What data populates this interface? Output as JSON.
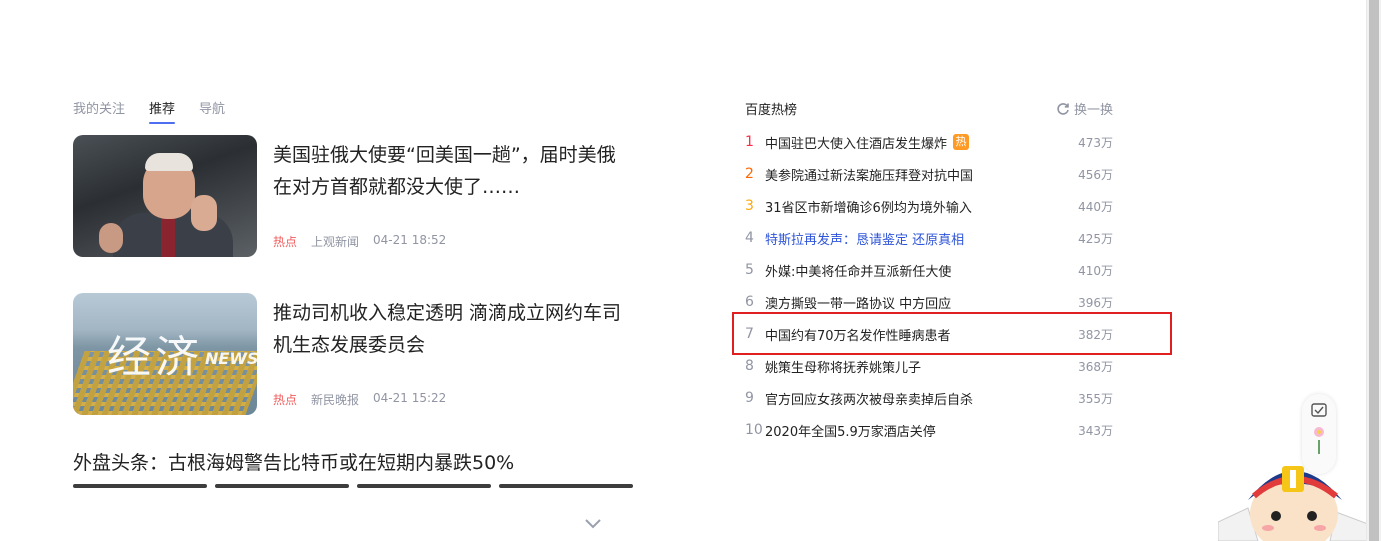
{
  "tabs": [
    {
      "label": "我的关注",
      "active": false
    },
    {
      "label": "推荐",
      "active": true
    },
    {
      "label": "导航",
      "active": false
    }
  ],
  "news": [
    {
      "title": "美国驻俄大使要“回美国一趟”，届时美俄在对方首都就都没大使了……",
      "tag": "热点",
      "source": "上观新闻",
      "time": "04-21 18:52"
    },
    {
      "title": "推动司机收入稳定透明 滴滴成立网约车司机生态发展委员会",
      "tag": "热点",
      "source": "新民晚报",
      "time": "04-21 15:22",
      "image_text": "经济",
      "image_text_en": "NEWS"
    }
  ],
  "headline3": "外盘头条：古根海姆警告比特币或在短期内暴跌50%",
  "hot": {
    "title": "百度热榜",
    "refresh_label": "换一换",
    "items": [
      {
        "rank": "1",
        "text": "中国驻巴大使入住酒店发生爆炸",
        "tag": "热",
        "count": "473万"
      },
      {
        "rank": "2",
        "text": "美参院通过新法案施压拜登对抗中国",
        "count": "456万"
      },
      {
        "rank": "3",
        "text": "31省区市新增确诊6例均为境外输入",
        "count": "440万"
      },
      {
        "rank": "4",
        "text": "特斯拉再发声：恳请鉴定 还原真相",
        "count": "425万",
        "blue": true
      },
      {
        "rank": "5",
        "text": "外媒:中美将任命并互派新任大使",
        "count": "410万"
      },
      {
        "rank": "6",
        "text": "澳方撕毁一带一路协议 中方回应",
        "count": "396万"
      },
      {
        "rank": "7",
        "text": "中国约有70万名发作性睡病患者",
        "count": "382万"
      },
      {
        "rank": "8",
        "text": "姚策生母称将抚养姚策儿子",
        "count": "368万"
      },
      {
        "rank": "9",
        "text": "官方回应女孩两次被母亲卖掉后自杀",
        "count": "355万"
      },
      {
        "rank": "10",
        "text": "2020年全国5.9万家酒店关停",
        "count": "343万"
      }
    ]
  }
}
